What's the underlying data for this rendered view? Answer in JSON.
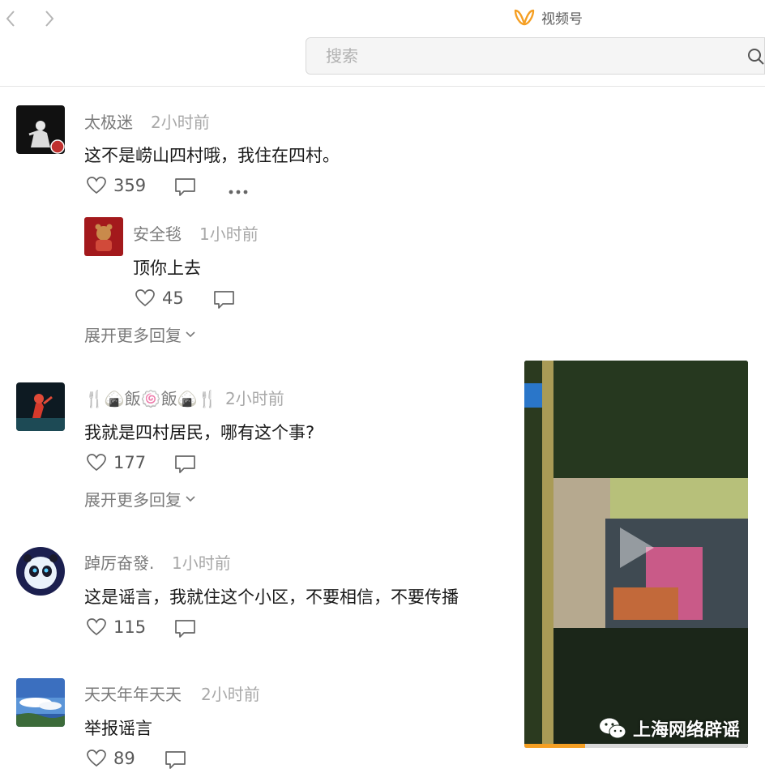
{
  "header": {
    "brand_label": "视频号",
    "search_placeholder": "搜索"
  },
  "comments": [
    {
      "name": "太极迷",
      "time": "2小时前",
      "text": "这不是崂山四村哦，我住在四村。",
      "likes": "359",
      "replies": [
        {
          "name": "安全毯",
          "time": "1小时前",
          "text": "顶你上去",
          "likes": "45"
        }
      ],
      "more_replies_label": "展开更多回复"
    },
    {
      "name": "🍴🍙飯🍥飯🍙🍴",
      "time": "2小时前",
      "text": "我就是四村居民，哪有这个事?",
      "likes": "177",
      "more_replies_label": "展开更多回复"
    },
    {
      "name": "踔厉奋發.",
      "time": "1小时前",
      "text": "这是谣言，我就住这个小区，不要相信，不要传播",
      "likes": "115"
    },
    {
      "name": "天天年年天天",
      "time": "2小时前",
      "text": "举报谣言",
      "likes": "89"
    }
  ],
  "video": {
    "watermark": "上海网络辟谣",
    "progress": 0.27
  },
  "colors": {
    "accent": "#f59f23",
    "text": "#191919",
    "muted": "#a8a8a8"
  }
}
